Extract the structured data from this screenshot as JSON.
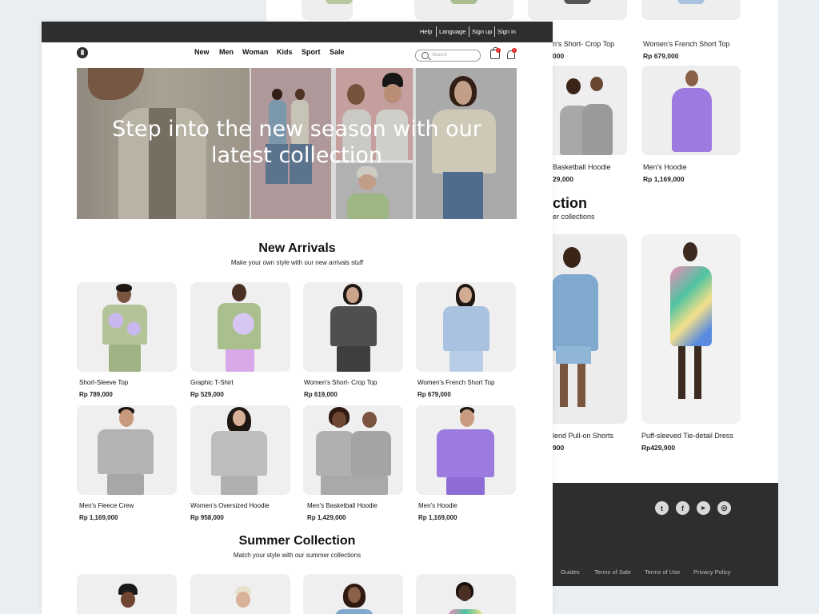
{
  "topbar": {
    "links": [
      "Help",
      "Language",
      "Sign up",
      "Sign in"
    ]
  },
  "nav": {
    "items": [
      "New",
      "Men",
      "Woman",
      "Kids",
      "Sport",
      "Sale"
    ]
  },
  "search": {
    "placeholder": "Search"
  },
  "icons": {
    "logo": "store-logo-icon",
    "search": "search-icon",
    "bag": "shopping-bag-icon",
    "notifications": "bell-icon"
  },
  "badges": {
    "bag": "1",
    "notifications": "1"
  },
  "hero": {
    "title": "Step into the new season with our latest collection"
  },
  "new_arrivals": {
    "title": "New Arrivals",
    "subtitle": "Make your own style with our new arrivals stuff",
    "products": [
      {
        "name": "Short-Sleeve  Top",
        "price": "Rp 789,000"
      },
      {
        "name": "Graphic T-Shirt",
        "price": "Rp 529,000"
      },
      {
        "name": "Women's Short- Crop Top",
        "price": "Rp 619,000"
      },
      {
        "name": "Women's French Short Top",
        "price": "Rp 679,000"
      },
      {
        "name": "Men's Fleece Crew",
        "price": "Rp 1,169,000"
      },
      {
        "name": "Women's Oversized Hoodie",
        "price": "Rp 958,000"
      },
      {
        "name": "Men's Basketball Hoodie",
        "price": "Rp 1,429,000"
      },
      {
        "name": "Men's Hoodie",
        "price": "Rp 1,169,000"
      }
    ]
  },
  "summer_collection": {
    "title": "Summer Collection",
    "subtitle": "Match your style with our summer collections"
  },
  "back_page": {
    "row1": [
      {
        "name": "n's Short- Crop Top",
        "price": "000"
      },
      {
        "name": "Women's French Short Top",
        "price": "Rp 679,000"
      }
    ],
    "row2": [
      {
        "name": "Basketball Hoodie",
        "price": "29,000"
      },
      {
        "name": "Men's Hoodie",
        "price": "Rp 1,169,000"
      }
    ],
    "section_title": "ction",
    "section_sub": "er collections",
    "row3": [
      {
        "name": "lend Pull-on Shorts",
        "price": "900"
      },
      {
        "name": "Puff-sleeved Tie-detail Dress",
        "price": "Rp429,900"
      }
    ]
  },
  "footer": {
    "social": [
      "twitter-icon",
      "facebook-icon",
      "youtube-icon",
      "instagram-icon"
    ],
    "links": [
      "Guides",
      "Terms of Sale",
      "Terms of Use",
      "Privacy Policy"
    ]
  },
  "colors": {
    "dark": "#2e2e2e",
    "badge": "#e02020",
    "card": "#efefef",
    "hoodie_purple": "#9b7be0"
  }
}
